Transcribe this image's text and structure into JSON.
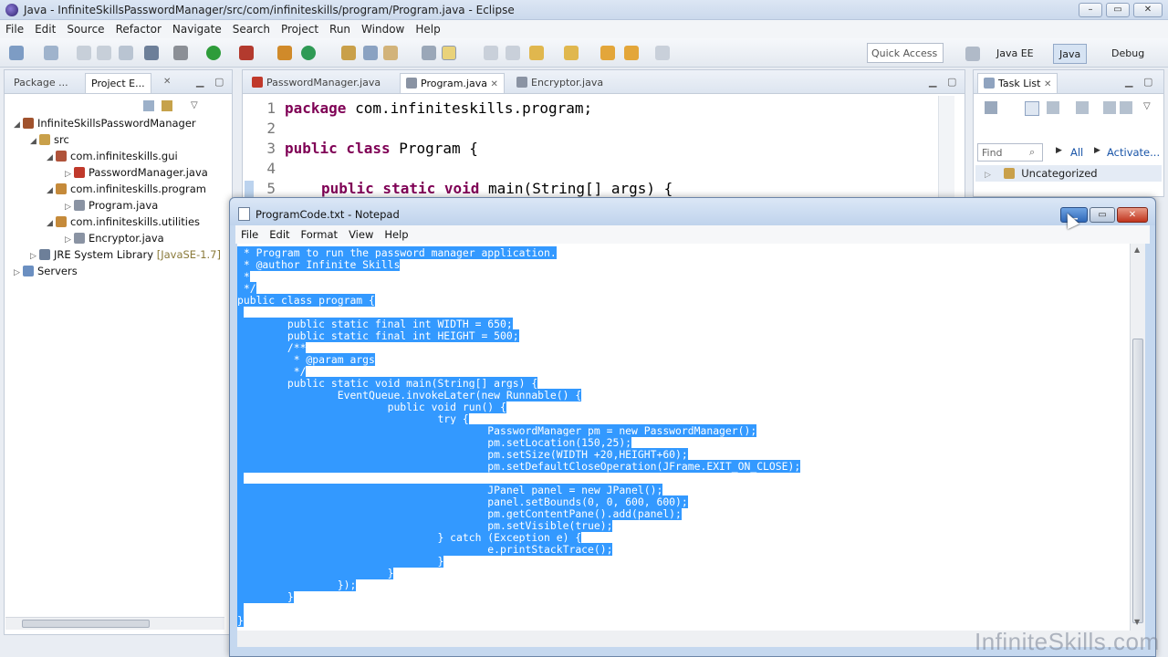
{
  "eclipse": {
    "title": "Java - InfiniteSkillsPasswordManager/src/com/infiniteskills/program/Program.java - Eclipse",
    "menu": [
      "File",
      "Edit",
      "Source",
      "Refactor",
      "Navigate",
      "Search",
      "Project",
      "Run",
      "Window",
      "Help"
    ],
    "quick_access": "Quick Access",
    "perspectives": [
      "Java EE",
      "Java",
      "Debug"
    ]
  },
  "left_panel": {
    "tabs": [
      "Package ...",
      "Project E..."
    ],
    "tree": [
      {
        "label": "InfiniteSkillsPasswordManager"
      },
      {
        "label": "src"
      },
      {
        "label": "com.infiniteskills.gui"
      },
      {
        "label": "PasswordManager.java"
      },
      {
        "label": "com.infiniteskills.program"
      },
      {
        "label": "Program.java"
      },
      {
        "label": "com.infiniteskills.utilities"
      },
      {
        "label": "Encryptor.java"
      },
      {
        "label": "JRE System Library",
        "suffix": "[JavaSE-1.7]"
      },
      {
        "label": "Servers"
      }
    ]
  },
  "editor": {
    "tabs": [
      "PasswordManager.java",
      "Program.java",
      "Encryptor.java"
    ],
    "line_numbers": [
      "1",
      "2",
      "3",
      "4",
      "5"
    ],
    "lines": [
      {
        "kw": "package",
        "rest": " com.infiniteskills.program;"
      },
      {
        "kw": "",
        "rest": ""
      },
      {
        "kw": "public class",
        "rest": " Program {"
      },
      {
        "kw": "",
        "rest": ""
      },
      {
        "kw": "public static void",
        "rest": " main(String[] args) {"
      }
    ]
  },
  "right_panel": {
    "tab": "Task List",
    "find_placeholder": "Find",
    "all": "All",
    "activate": "Activate...",
    "category": "Uncategorized"
  },
  "notepad": {
    "title": "ProgramCode.txt - Notepad",
    "menu": [
      "File",
      "Edit",
      "Format",
      "View",
      "Help"
    ],
    "lines": [
      " * Program to run the password manager application.",
      " * @author Infinite Skills",
      " *",
      " */",
      "public class program {",
      "",
      "        public static final int WIDTH = 650;",
      "        public static final int HEIGHT = 500;",
      "        /**",
      "         * @param args",
      "         */",
      "        public static void main(String[] args) {",
      "                EventQueue.invokeLater(new Runnable() {",
      "                        public void run() {",
      "                                try {",
      "                                        PasswordManager pm = new PasswordManager();",
      "                                        pm.setLocation(150,25);",
      "                                        pm.setSize(WIDTH +20,HEIGHT+60);",
      "                                        pm.setDefaultCloseOperation(JFrame.EXIT_ON_CLOSE);",
      "",
      "                                        JPanel panel = new JPanel();",
      "                                        panel.setBounds(0, 0, 600, 600);",
      "                                        pm.getContentPane().add(panel);",
      "                                        pm.setVisible(true);",
      "                                } catch (Exception e) {",
      "                                        e.printStackTrace();",
      "                                }",
      "                        }",
      "                });",
      "        }",
      "",
      "}"
    ]
  },
  "watermark": "InfiniteSkills.com"
}
